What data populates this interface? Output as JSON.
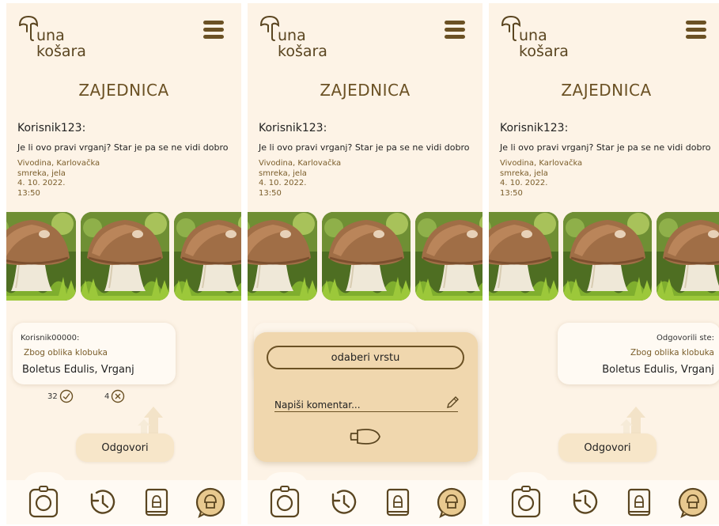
{
  "app": {
    "name_line1": "una",
    "name_line2": "košara"
  },
  "page": {
    "title": "ZAJEDNICA"
  },
  "post": {
    "user": "Korisnik123:",
    "question": "Je li ovo pravi vrganj? Star je pa se ne vidi dobro",
    "location": "Vivodina, Karlovačka",
    "trees": "smreka, jela",
    "date": "4. 10. 2022.",
    "time": "13:50"
  },
  "answer": {
    "user": "Korisnik00000:",
    "reason": "Zbog oblika klobuka",
    "species": "Boletus Edulis, Vrganj",
    "upvotes": "32",
    "downvotes": "4"
  },
  "my_answer": {
    "label": "Odgovorili ste:",
    "reason": "Zbog oblika klobuka",
    "species": "Boletus Edulis, Vrganj"
  },
  "reply_button": "Odgovori",
  "reply_form": {
    "select_label": "odaberi vrstu",
    "comment_placeholder": "Napiši komentar..."
  },
  "nav_icons": [
    "camera-icon",
    "history-icon",
    "book-icon",
    "community-chat-icon"
  ],
  "colors": {
    "background": "#fdf3e6",
    "accent": "#6b5124",
    "card": "#fffaf3",
    "form": "#f0d7ae"
  }
}
